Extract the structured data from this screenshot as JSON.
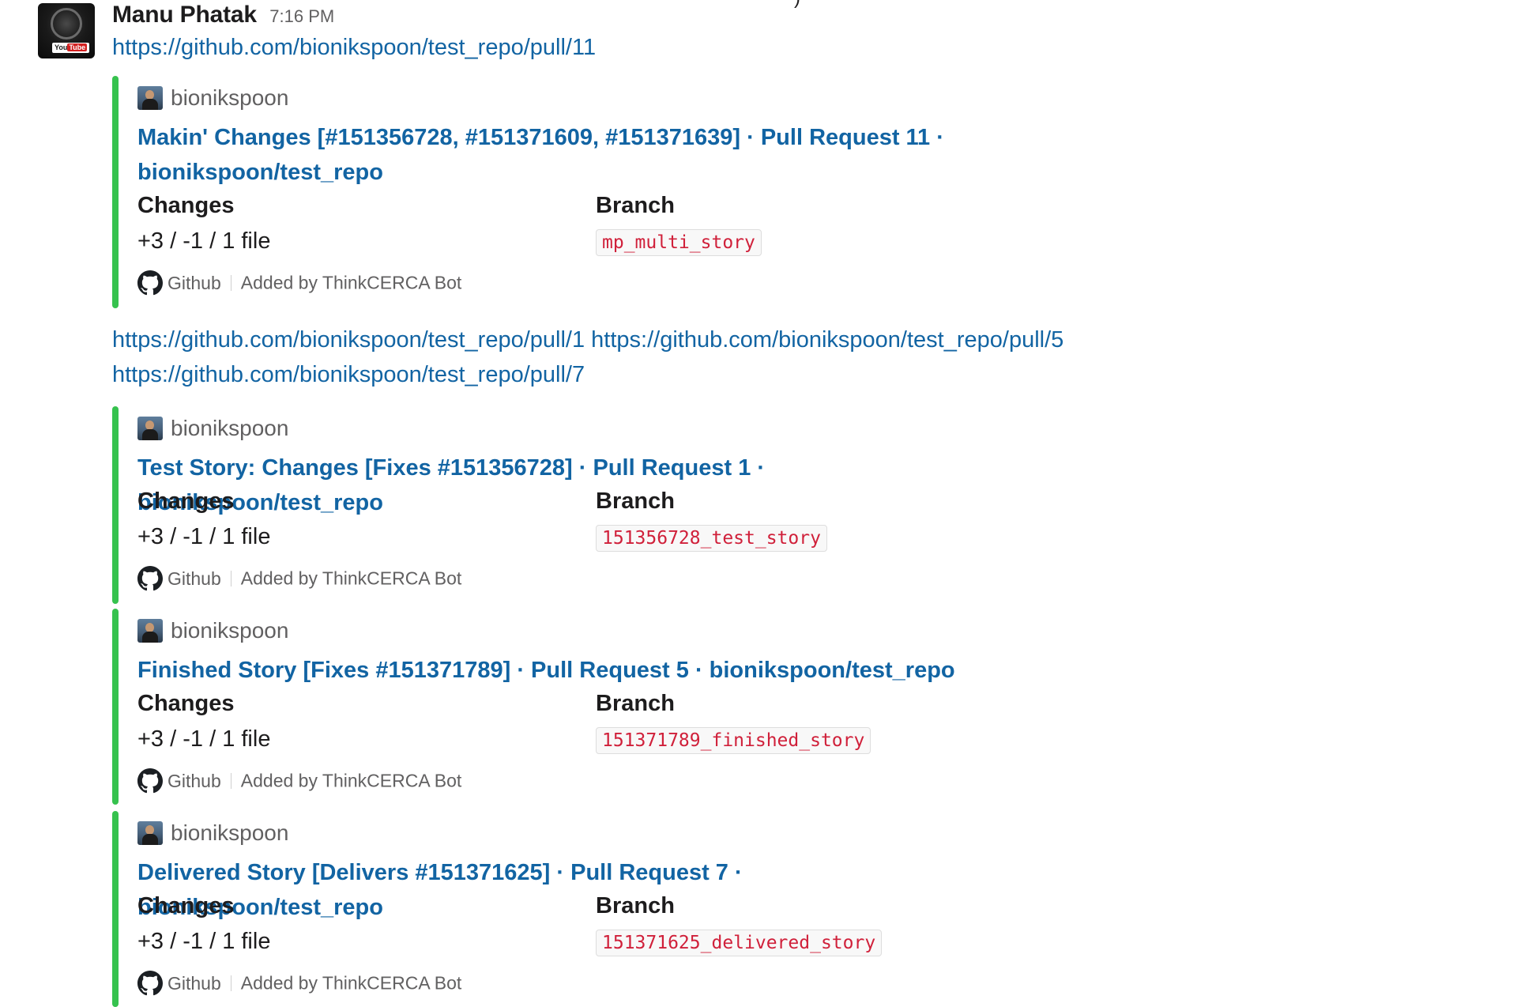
{
  "top_cutoff_text": ")",
  "message": {
    "sender": "Manu Phatak",
    "time": "7:16 PM",
    "avatar_badge_you": "You",
    "avatar_badge_tube": "Tube",
    "link_main": "https://github.com/bionikspoon/test_repo/pull/11",
    "link_pr1": "https://github.com/bionikspoon/test_repo/pull/1",
    "link_pr5": "https://github.com/bionikspoon/test_repo/pull/5",
    "link_pr7": "https://github.com/bionikspoon/test_repo/pull/7"
  },
  "attachments": [
    {
      "author": "bionikspoon",
      "title": "Makin' Changes [#151356728, #151371609, #151371639] · Pull Request 11 · bionikspoon/test_repo",
      "changes_label": "Changes",
      "changes_value": "+3 / -1 / 1 file",
      "branch_label": "Branch",
      "branch_value": "mp_multi_story",
      "footer_source": "Github",
      "footer_added_by": "Added by ThinkCERCA Bot"
    },
    {
      "author": "bionikspoon",
      "title": "Test Story: Changes [Fixes #151356728] · Pull Request 1 · bionikspoon/test_repo",
      "changes_label": "Changes",
      "changes_value": "+3 / -1 / 1 file",
      "branch_label": "Branch",
      "branch_value": "151356728_test_story",
      "footer_source": "Github",
      "footer_added_by": "Added by ThinkCERCA Bot"
    },
    {
      "author": "bionikspoon",
      "title": "Finished Story [Fixes #151371789] · Pull Request 5 · bionikspoon/test_repo",
      "changes_label": "Changes",
      "changes_value": "+3 / -1 / 1 file",
      "branch_label": "Branch",
      "branch_value": "151371789_finished_story",
      "footer_source": "Github",
      "footer_added_by": "Added by ThinkCERCA Bot"
    },
    {
      "author": "bionikspoon",
      "title": "Delivered Story [Delivers #151371625] · Pull Request 7 · bionikspoon/test_repo",
      "changes_label": "Changes",
      "changes_value": "+3 / -1 / 1 file",
      "branch_label": "Branch",
      "branch_value": "151371625_delivered_story",
      "footer_source": "Github",
      "footer_added_by": "Added by ThinkCERCA Bot"
    }
  ],
  "icons": {
    "footer_service": "github-icon",
    "author": "author-avatar"
  },
  "colors": {
    "link": "#1264a3",
    "attachment_bar": "#36c24e",
    "code_text": "#d0203a",
    "muted": "#616061"
  }
}
